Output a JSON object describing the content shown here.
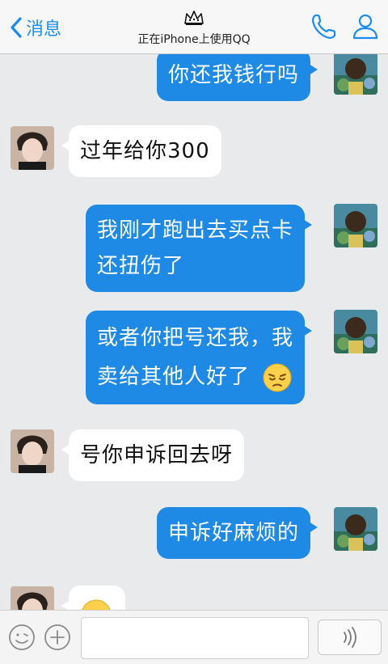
{
  "header": {
    "back_label": "消息",
    "title": "正在iPhone上使用QQ"
  },
  "messages": [
    {
      "from": "me",
      "text": "你还我钱行吗"
    },
    {
      "from": "friend",
      "text": "过年给你300"
    },
    {
      "from": "me",
      "line1": "我刚才跑出去买点卡",
      "line2": "还扭伤了"
    },
    {
      "from": "me",
      "line1": "或者你把号还我，我",
      "line2": "卖给其他人好了"
    },
    {
      "from": "friend",
      "text": "号你申诉回去呀"
    },
    {
      "from": "me",
      "text": "申诉好麻烦的"
    }
  ],
  "colors": {
    "accent": "#1e8ae6",
    "chat_background": "#e9eaec"
  }
}
